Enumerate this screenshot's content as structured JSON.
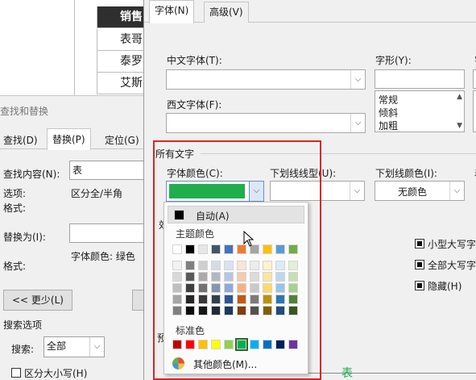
{
  "sheet": {
    "header": "销售员",
    "rows": [
      "表哥",
      "泰罗",
      "艾斯"
    ]
  },
  "find_replace": {
    "title": "查找和替换",
    "tabs": [
      "查找(D)",
      "替换(P)",
      "定位(G)"
    ],
    "find_label": "查找内容(N):",
    "find_value": "表",
    "options_label": "选项:",
    "options_value": "区分全/半角",
    "format_label": "格式:",
    "replace_label": "替换为(I):",
    "replace_value": "",
    "format2_label": "格式:",
    "format2_value": "字体颜色: 绿色",
    "less_button": "<< 更少(L)",
    "search_options": "搜索选项",
    "search_label": "搜索:",
    "search_value": "全部",
    "match_case": "区分大小写(H)"
  },
  "font_dialog": {
    "tabs": [
      "字体(N)",
      "高级(V)"
    ],
    "chinese_font_label": "中文字体(T):",
    "western_font_label": "西文字体(F):",
    "style_label": "字形(Y):",
    "style_items": [
      "常规",
      "倾斜",
      "加粗"
    ],
    "size_label": "字号",
    "all_text_label": "所有文字",
    "font_color_label": "字体颜色(C):",
    "underline_type_label": "下划线线型(U):",
    "underline_color_label": "下划线颜色(I):",
    "underline_color_value": "无颜色",
    "emphasis_label": "着",
    "effects_label": "效",
    "small_caps": "小型大写字",
    "all_caps": "全部大写字",
    "hidden": "隐藏(H)",
    "preview_label": "预",
    "preview_char": "表",
    "font_color_value": "#1fae4b",
    "accent_highlight": "#d9262a"
  },
  "palette": {
    "auto_label": "自动(A)",
    "theme_label": "主题颜色",
    "standard_label": "标准色",
    "more_label": "其他颜色(M)...",
    "theme_top": [
      "#ffffff",
      "#000000",
      "#e7e6e6",
      "#44546a",
      "#4472c4",
      "#ed7d31",
      "#a5a5a5",
      "#ffc000",
      "#5b9bd5",
      "#70ad47"
    ],
    "theme_shades": [
      [
        "#f2f2f2",
        "#7f7f7f",
        "#d0cece",
        "#d6dce4",
        "#d9e2f3",
        "#fbe5d5",
        "#ededed",
        "#fff2cc",
        "#deebf6",
        "#e2efd9"
      ],
      [
        "#d8d8d8",
        "#595959",
        "#aeaaaa",
        "#adb9ca",
        "#b4c6e7",
        "#f7cbac",
        "#dbdbdb",
        "#fee599",
        "#bdd7ee",
        "#c5e0b3"
      ],
      [
        "#bfbfbf",
        "#3f3f3f",
        "#757070",
        "#8496b0",
        "#8eaadb",
        "#f4b183",
        "#c9c9c9",
        "#ffd965",
        "#9cc3e5",
        "#a8d08d"
      ],
      [
        "#a5a5a5",
        "#262626",
        "#3a3838",
        "#323f4f",
        "#2f5496",
        "#c45911",
        "#7b7b7b",
        "#bf9000",
        "#2e75b5",
        "#538135"
      ],
      [
        "#7f7f7f",
        "#0c0c0c",
        "#171616",
        "#222a35",
        "#1e3864",
        "#833c0b",
        "#525252",
        "#7f6000",
        "#1e4e79",
        "#375623"
      ]
    ],
    "standard": [
      "#c00000",
      "#ff0000",
      "#ffc000",
      "#ffff00",
      "#92d050",
      "#00b050",
      "#00b0f0",
      "#0070c0",
      "#002060",
      "#7030a0"
    ],
    "selected_standard_index": 5
  }
}
